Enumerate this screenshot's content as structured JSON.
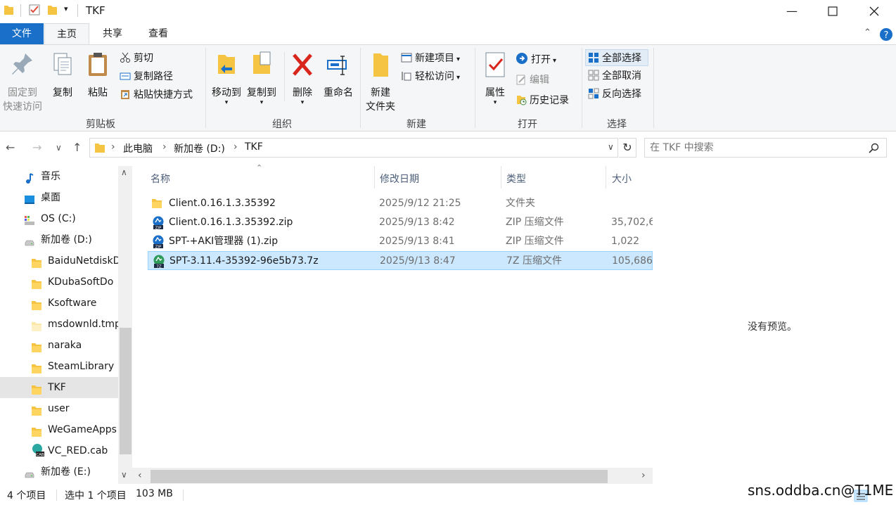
{
  "window": {
    "title": "TKF"
  },
  "tabs": {
    "file": "文件",
    "home": "主页",
    "share": "共享",
    "view": "查看"
  },
  "ribbon": {
    "clipboard": {
      "label": "剪贴板",
      "pin_line1": "固定到",
      "pin_line2": "快速访问",
      "copy": "复制",
      "paste": "粘贴",
      "cut": "剪切",
      "copy_path": "复制路径",
      "paste_shortcut": "粘贴快捷方式"
    },
    "organize": {
      "label": "组织",
      "move_to": "移动到",
      "copy_to": "复制到",
      "delete": "删除",
      "rename": "重命名"
    },
    "new": {
      "label": "新建",
      "new_folder_line1": "新建",
      "new_folder_line2": "文件夹",
      "new_item": "新建项目",
      "easy_access": "轻松访问"
    },
    "open": {
      "label": "打开",
      "properties": "属性",
      "open": "打开",
      "edit": "编辑",
      "history": "历史记录"
    },
    "select": {
      "label": "选择",
      "select_all": "全部选择",
      "select_none": "全部取消",
      "invert": "反向选择"
    }
  },
  "address": {
    "crumbs": [
      "此电脑",
      "新加卷 (D:)",
      "TKF"
    ],
    "search_placeholder": "在 TKF 中搜索"
  },
  "nav": [
    {
      "label": "音乐",
      "icon": "music-icon",
      "indent": 1
    },
    {
      "label": "桌面",
      "icon": "desktop-icon",
      "indent": 1
    },
    {
      "label": "OS (C:)",
      "icon": "os-drive-icon",
      "indent": 1
    },
    {
      "label": "新加卷 (D:)",
      "icon": "drive-icon",
      "indent": 1
    },
    {
      "label": "BaiduNetdiskD",
      "icon": "folder-icon",
      "indent": 2
    },
    {
      "label": "KDubaSoftDo",
      "icon": "folder-icon",
      "indent": 2
    },
    {
      "label": "Ksoftware",
      "icon": "folder-icon",
      "indent": 2
    },
    {
      "label": "msdownld.tmp",
      "icon": "folder-light-icon",
      "indent": 2
    },
    {
      "label": "naraka",
      "icon": "folder-icon",
      "indent": 2
    },
    {
      "label": "SteamLibrary",
      "icon": "folder-icon",
      "indent": 2
    },
    {
      "label": "TKF",
      "icon": "folder-icon",
      "indent": 2,
      "selected": true
    },
    {
      "label": "user",
      "icon": "folder-icon",
      "indent": 2
    },
    {
      "label": "WeGameApps",
      "icon": "folder-icon",
      "indent": 2
    },
    {
      "label": "VC_RED.cab",
      "icon": "cab-file-icon",
      "indent": 2
    },
    {
      "label": "新加卷 (E:)",
      "icon": "drive-icon",
      "indent": 1
    }
  ],
  "list": {
    "columns": {
      "name": "名称",
      "modified": "修改日期",
      "type": "类型",
      "size": "大小"
    },
    "rows": [
      {
        "name": "Client.0.16.1.3.35392",
        "modified": "2025/9/12 21:25",
        "type": "文件夹",
        "size": "",
        "icon": "folder-icon"
      },
      {
        "name": "Client.0.16.1.3.35392.zip",
        "modified": "2025/9/13 8:42",
        "type": "ZIP 压缩文件",
        "size": "35,702,6",
        "icon": "zip-file-icon"
      },
      {
        "name": "SPT-+AKI管理器 (1).zip",
        "modified": "2025/9/13 8:41",
        "type": "ZIP 压缩文件",
        "size": "1,022",
        "icon": "zip-file-icon"
      },
      {
        "name": "SPT-3.11.4-35392-96e5b73.7z",
        "modified": "2025/9/13 8:47",
        "type": "7Z 压缩文件",
        "size": "105,686",
        "icon": "7z-file-icon",
        "selected": true
      }
    ]
  },
  "preview": {
    "text": "没有预览。"
  },
  "status": {
    "count": "4 个项目",
    "selected": "选中 1 个项目",
    "size": "103 MB"
  },
  "watermark": "sns.oddba.cn@T1ME",
  "colors": {
    "accent": "#1a6fc9",
    "selection": "#cce8ff",
    "folder": "#f6c443"
  }
}
